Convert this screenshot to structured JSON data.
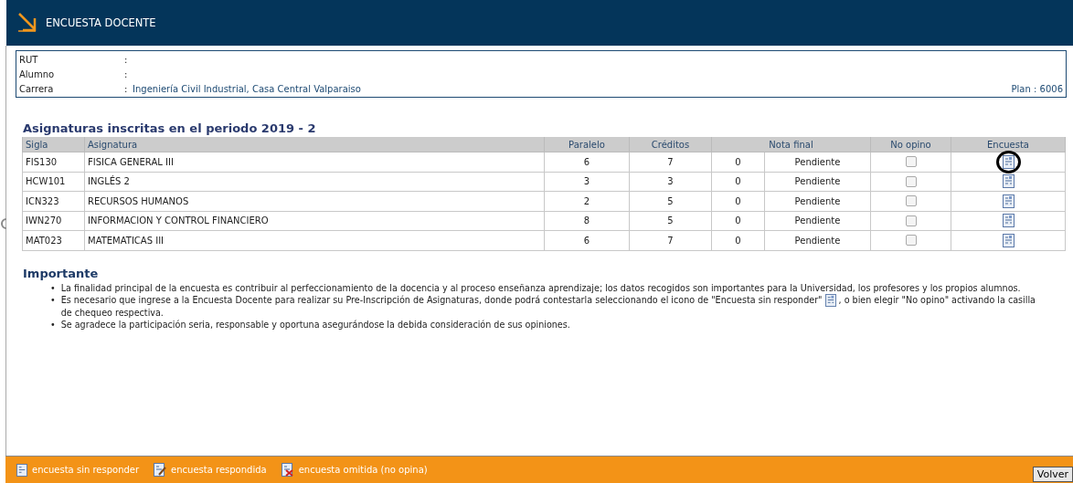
{
  "header": {
    "title": "ENCUESTA DOCENTE"
  },
  "info": [
    {
      "label": "RUT"
    },
    {
      "label": "Alumno"
    },
    {
      "label": "Carrera",
      "value": "Ingeniería Civil Industrial, Casa Central Valparaiso"
    }
  ],
  "separator": ":",
  "plan": "Plan : 6006",
  "section_title": "Asignaturas inscritas en el periodo 2019 - 2",
  "table": {
    "columns": [
      "Sigla",
      "Asignatura",
      "Paralelo",
      "Créditos",
      "Nota final",
      "No opino",
      "Encuesta"
    ],
    "rows": [
      {
        "sigla": "FIS130",
        "asignatura": "FISICA GENERAL III",
        "paralelo": "6",
        "creditos": "7",
        "nota": "0",
        "estado": "Pendiente",
        "no_opino": false,
        "highlighted": true
      },
      {
        "sigla": "HCW101",
        "asignatura": "INGLÉS 2",
        "paralelo": "3",
        "creditos": "3",
        "nota": "0",
        "estado": "Pendiente",
        "no_opino": false,
        "highlighted": false
      },
      {
        "sigla": "ICN323",
        "asignatura": "RECURSOS HUMANOS",
        "paralelo": "2",
        "creditos": "5",
        "nota": "0",
        "estado": "Pendiente",
        "no_opino": false,
        "highlighted": false
      },
      {
        "sigla": "IWN270",
        "asignatura": "INFORMACION Y CONTROL FINANCIERO",
        "paralelo": "8",
        "creditos": "5",
        "nota": "0",
        "estado": "Pendiente",
        "no_opino": false,
        "highlighted": false
      },
      {
        "sigla": "MAT023",
        "asignatura": "MATEMATICAS III",
        "paralelo": "6",
        "creditos": "7",
        "nota": "0",
        "estado": "Pendiente",
        "no_opino": false,
        "highlighted": false
      }
    ]
  },
  "important": {
    "title": "Importante",
    "bullets": [
      {
        "marker": "•",
        "text": "La finalidad principal de la encuesta es contribuir al perfeccionamiento de la docencia y al proceso enseñanza aprendizaje; los datos recogidos son importantes para la Universidad, los profesores y los propios alumnos."
      },
      {
        "marker": "•",
        "text": "Es necesario que ingrese a la Encuesta Docente para realizar su Pre-Inscripción de Asignaturas, donde podrá contestarla seleccionando el icono de \"Encuesta sin responder\"",
        "text_after": ", o bien elegir \"No opino\" activando la casilla",
        "text_continued": "de chequeo respectiva."
      },
      {
        "marker": "•",
        "text": "Se agradece la participación seria, responsable y oportuna asegurándose la debida consideración de sus opiniones."
      }
    ]
  },
  "legend": [
    {
      "kind": "pending",
      "label": "encuesta sin responder"
    },
    {
      "kind": "answered",
      "label": "encuesta respondida"
    },
    {
      "kind": "omitted",
      "label": "encuesta omitida (no opina)"
    }
  ],
  "back_button": "Volver"
}
